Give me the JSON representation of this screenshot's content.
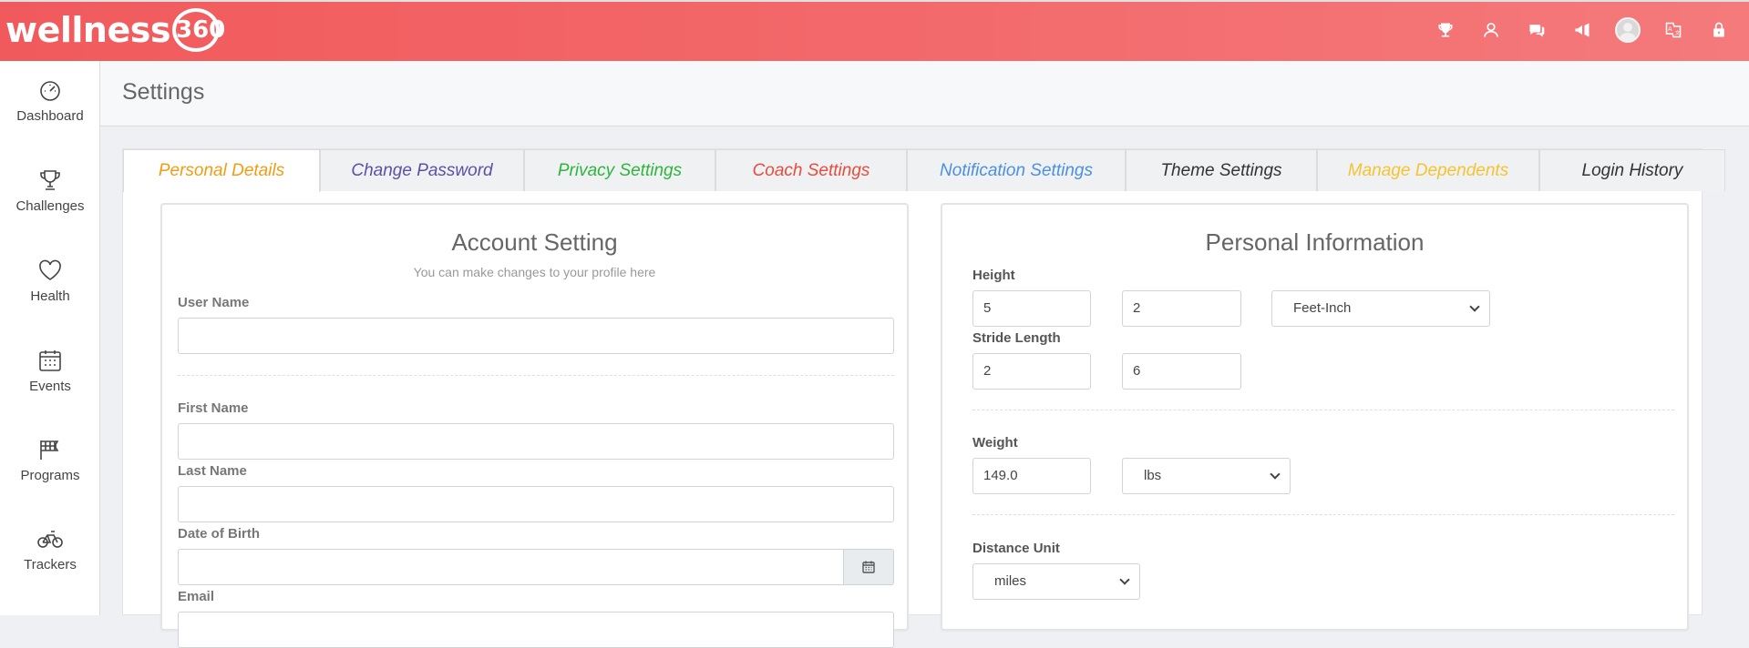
{
  "header": {
    "logo": {
      "text": "wellness",
      "badge": "360"
    },
    "icons": [
      {
        "name": "trophy-icon"
      },
      {
        "name": "user-coach-icon"
      },
      {
        "name": "chat-icon"
      },
      {
        "name": "megaphone-icon"
      },
      {
        "name": "avatar"
      },
      {
        "name": "language-icon"
      },
      {
        "name": "lock-icon"
      }
    ]
  },
  "sidebar": {
    "items": [
      {
        "label": "Dashboard",
        "icon": "dashboard-icon"
      },
      {
        "label": "Challenges",
        "icon": "trophy-icon"
      },
      {
        "label": "Health",
        "icon": "heart-icon"
      },
      {
        "label": "Events",
        "icon": "calendar-icon"
      },
      {
        "label": "Programs",
        "icon": "flag-icon"
      },
      {
        "label": "Trackers",
        "icon": "bicycle-icon"
      }
    ]
  },
  "page": {
    "title": "Settings"
  },
  "tabs": [
    {
      "label": "Personal Details",
      "color": "#f39c12",
      "active": true
    },
    {
      "label": "Change Password",
      "color": "#5b4fa8",
      "active": false
    },
    {
      "label": "Privacy Settings",
      "color": "#2db53c",
      "active": false
    },
    {
      "label": "Coach Settings",
      "color": "#e74c3c",
      "active": false
    },
    {
      "label": "Notification Settings",
      "color": "#4a90e2",
      "active": false
    },
    {
      "label": "Theme Settings",
      "color": "#333333",
      "active": false
    },
    {
      "label": "Manage Dependents",
      "color": "#f4c430",
      "active": false
    },
    {
      "label": "Login History",
      "color": "#333333",
      "active": false
    }
  ],
  "account": {
    "title": "Account Setting",
    "subtitle": "You can make changes to your profile here",
    "user_name_label": "User Name",
    "user_name_value": "",
    "first_name_label": "First Name",
    "first_name_value": "",
    "last_name_label": "Last Name",
    "last_name_value": "",
    "dob_label": "Date of Birth",
    "dob_value": "",
    "email_label": "Email"
  },
  "personal": {
    "title": "Personal Information",
    "height_label": "Height",
    "height_feet": "5",
    "height_inches": "2",
    "height_unit": "Feet-Inch",
    "stride_label": "Stride Length",
    "stride_feet": "2",
    "stride_inches": "6",
    "weight_label": "Weight",
    "weight_value": "149.0",
    "weight_unit": "lbs",
    "distance_label": "Distance Unit",
    "distance_unit": "miles"
  }
}
